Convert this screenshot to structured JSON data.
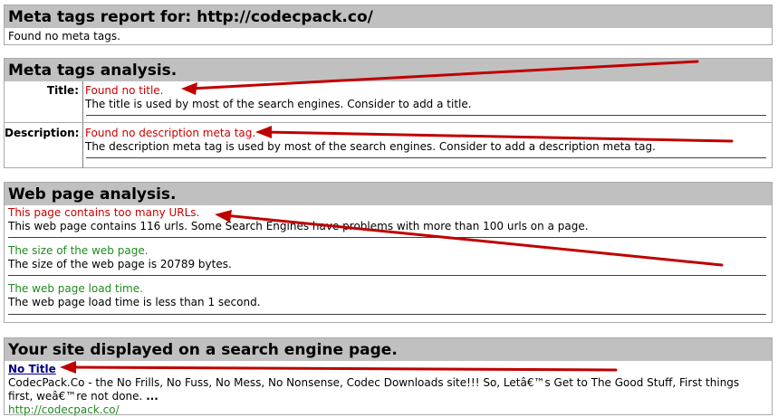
{
  "report": {
    "title": "Meta tags report for: http://codecpack.co/",
    "message": "Found no meta tags."
  },
  "analysis": {
    "title": "Meta tags analysis.",
    "rows": [
      {
        "label": "Title:",
        "status": "Found no title.",
        "detail": "The title is used by most of the search engines. Consider to add a title."
      },
      {
        "label": "Description:",
        "status": "Found no description meta tag.",
        "detail": "The description meta tag is used by most of the search engines. Consider to add a description meta tag."
      }
    ]
  },
  "webpage": {
    "title": "Web page analysis.",
    "items": [
      {
        "status": "This page contains too many URLs.",
        "detail": "This web page contains 116 urls. Some Search Engines have problems with more than 100 urls on a page."
      },
      {
        "status": "The size of the web page.",
        "detail": "The size of the web page is 20789 bytes."
      },
      {
        "status": "The web page load time.",
        "detail": "The web page load time is less than 1 second."
      }
    ]
  },
  "serp": {
    "title": "Your site displayed on a search engine page.",
    "link_title": "No Title",
    "snippet": "CodecPack.Co - the No Frills, No Fuss, No Mess, No Nonsense, Codec Downloads site!!! So, Letâ€™s Get to The Good Stuff, First things first, weâ€™re not done.",
    "ellipsis": "...",
    "url": "http://codecpack.co/"
  },
  "colors": {
    "header_bg": "#c0c0c0",
    "error": "#cc0000",
    "ok": "#1f8a1f",
    "link": "#000080",
    "arrow": "#c00000"
  }
}
